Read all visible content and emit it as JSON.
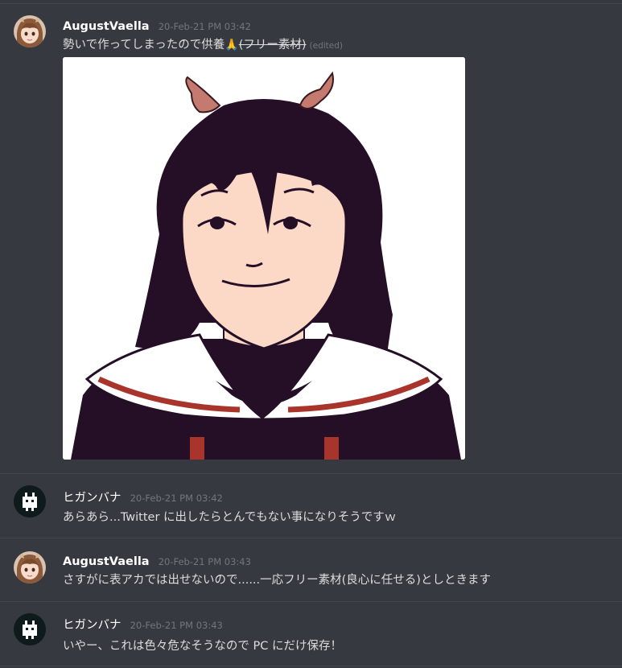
{
  "messages": [
    {
      "author": "AugustVaella",
      "timestamp": "20-Feb-21 PM 03:42",
      "text_main": "勢いで作ってしまったので供養",
      "emoji": "🙏",
      "text_strike": "(フリー素材)",
      "edited_label": "(edited)",
      "avatar_icon": "anime-girl-avatar-icon",
      "attachment": "anime-girl-with-horns-illustration"
    },
    {
      "author": "ヒガンバナ",
      "timestamp": "20-Feb-21 PM 03:42",
      "text": "あらあら...Twitter に出したらとんでもない事になりそうですｗ",
      "avatar_icon": "pixel-creature-avatar-icon"
    },
    {
      "author": "AugustVaella",
      "timestamp": "20-Feb-21 PM 03:43",
      "text": "さすがに表アカでは出せないので......一応フリー素材(良心に任せる)としときます",
      "avatar_icon": "anime-girl-avatar-icon"
    },
    {
      "author": "ヒガンバナ",
      "timestamp": "20-Feb-21 PM 03:43",
      "text": "いやー、これは色々危なそうなので PC にだけ保存！",
      "avatar_icon": "pixel-creature-avatar-icon"
    }
  ],
  "colors": {
    "background": "#36393f",
    "divider": "#42454a",
    "author": "#ffffff",
    "timestamp": "#72767d",
    "text": "#dcddde"
  }
}
